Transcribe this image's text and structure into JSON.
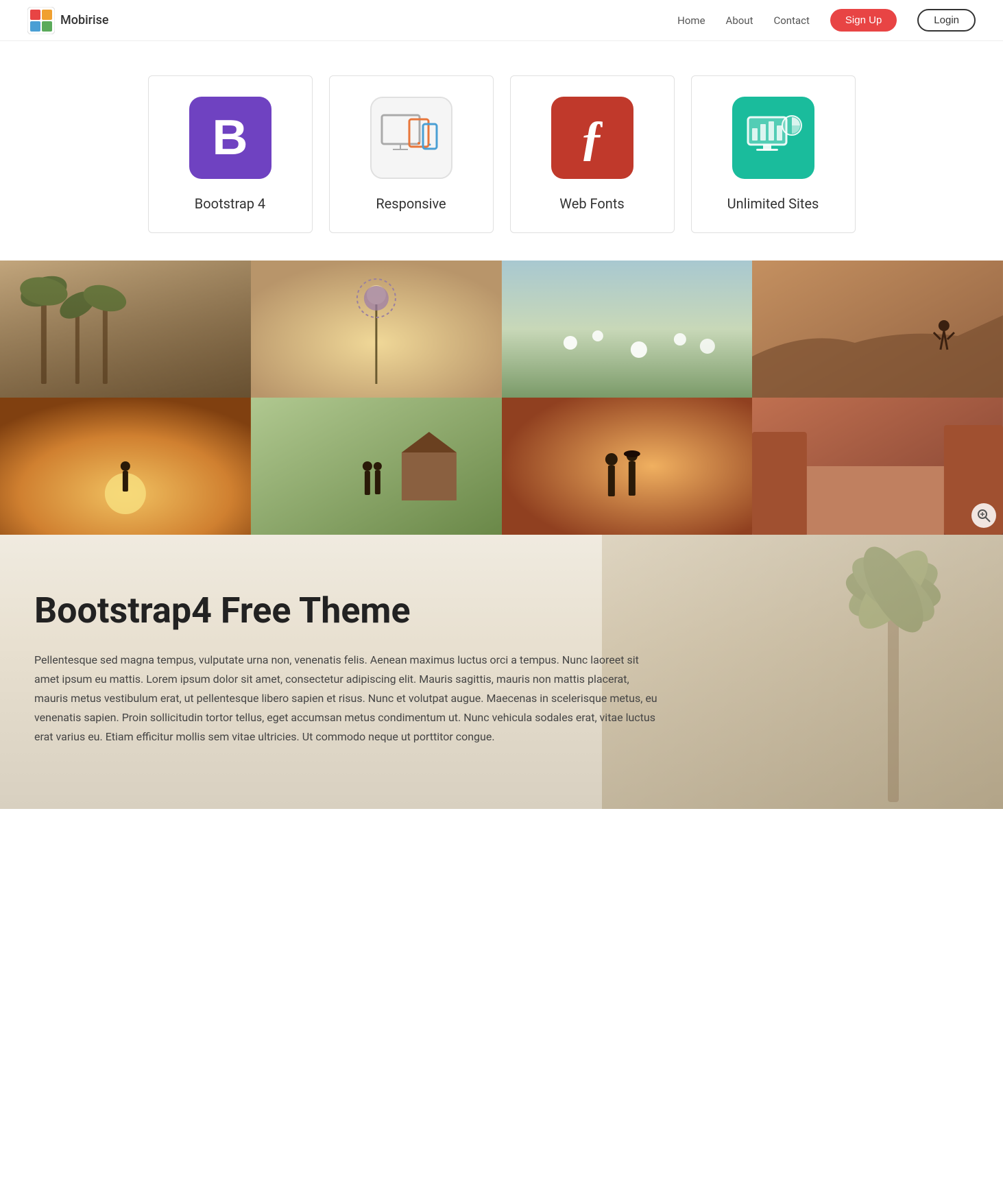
{
  "brand": {
    "name": "Mobirise"
  },
  "nav": {
    "links": [
      {
        "label": "Home",
        "href": "#"
      },
      {
        "label": "About",
        "href": "#"
      },
      {
        "label": "Contact",
        "href": "#"
      }
    ],
    "signup_label": "Sign Up",
    "login_label": "Login"
  },
  "features": [
    {
      "id": "bootstrap",
      "label": "Bootstrap 4",
      "icon_char": "B",
      "icon_class": "icon-bootstrap"
    },
    {
      "id": "responsive",
      "label": "Responsive",
      "icon_char": "",
      "icon_class": "icon-responsive"
    },
    {
      "id": "webfonts",
      "label": "Web Fonts",
      "icon_char": "ƒ",
      "icon_class": "icon-webfonts"
    },
    {
      "id": "unlimited",
      "label": "Unlimited Sites",
      "icon_char": "",
      "icon_class": "icon-unlimited"
    }
  ],
  "gallery": {
    "images": [
      {
        "alt": "Palm trees on beach",
        "class": "gc-1"
      },
      {
        "alt": "Purple flower bokeh",
        "class": "gc-2"
      },
      {
        "alt": "White flowers field",
        "class": "gc-3"
      },
      {
        "alt": "Woman on rocky landscape",
        "class": "gc-4"
      },
      {
        "alt": "Sunset silhouette",
        "class": "gc-5"
      },
      {
        "alt": "Wedding couple in field",
        "class": "gc-6"
      },
      {
        "alt": "Couple sunset portrait",
        "class": "gc-7"
      },
      {
        "alt": "Red rock cliffs",
        "class": "gc-8"
      }
    ],
    "zoom_icon": "⊕"
  },
  "content": {
    "heading": "Bootstrap4 Free Theme",
    "body": "Pellentesque sed magna tempus, vulputate urna non, venenatis felis. Aenean maximus luctus orci a tempus. Nunc laoreet sit amet ipsum eu mattis. Lorem ipsum dolor sit amet, consectetur adipiscing elit. Mauris sagittis, mauris non mattis placerat, mauris metus vestibulum erat, ut pellentesque libero sapien et risus. Nunc et volutpat augue. Maecenas in scelerisque metus, eu venenatis sapien. Proin sollicitudin tortor tellus, eget accumsan metus condimentum ut. Nunc vehicula sodales erat, vitae luctus erat varius eu. Etiam efficitur mollis sem vitae ultricies. Ut commodo neque ut porttitor congue."
  }
}
